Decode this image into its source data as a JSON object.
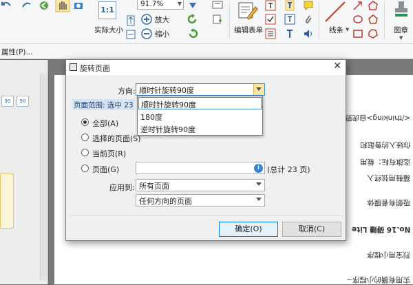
{
  "ribbon": {
    "zoom_value": "91.7%",
    "actual_size_label": "实际大小",
    "zoom_in_label": "放大",
    "zoom_out_label": "缩小",
    "edit_form_label": "编辑表单",
    "line_label": "线条",
    "stamp_label": "图章",
    "actual_size_icon_text": "1:1"
  },
  "menu": {
    "properties_label": "属性(P)..."
  },
  "left_panel": {
    "rotate_left_label": "90",
    "rotate_right_label": "90"
  },
  "document_lines": [
    "</thinking>自虎野",
    "你娃入的鲁酝和",
    "迄旗有耘：载用",
    "羅鞋用弦终入",
    "吸朝有者膜体",
    "No.16 碍赚 Lite",
    "烈宝用小程序",
    "实用有膳的小程序~"
  ],
  "dialog": {
    "title": "旋转页面",
    "direction_label": "方向:",
    "direction_value": "顺时针旋转90度",
    "direction_options": [
      "顺时针旋转90度",
      "180度",
      "逆时针旋转90度"
    ],
    "range_header": "页面范围: 选中 23",
    "radio_all": "全部(A)",
    "radio_selected": "选择的页面(S)",
    "radio_current": "当前页(R)",
    "radio_pages": "页面(G)",
    "pages_total": "(总计 23 页)",
    "apply_to_label": "应用到:",
    "apply_to_value": "所有页面",
    "orientation_value": "任何方向的页面",
    "ok_label": "确定(O)",
    "cancel_label": "取消(C)",
    "info_glyph": "i"
  }
}
